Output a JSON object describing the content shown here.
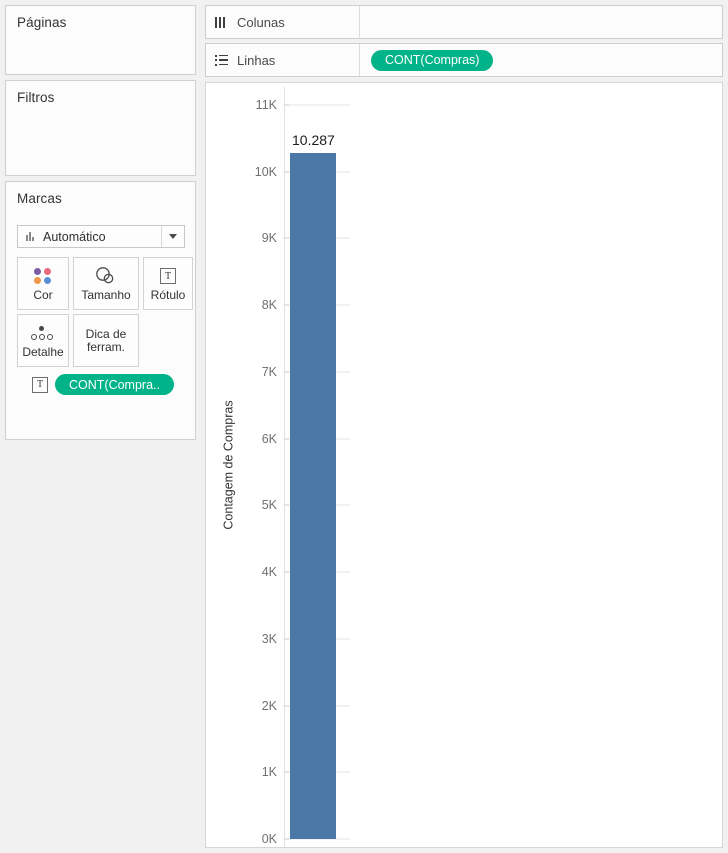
{
  "shelves": {
    "pages": {
      "title": "Páginas"
    },
    "filters": {
      "title": "Filtros"
    },
    "marks": {
      "title": "Marcas",
      "mark_type": "Automático",
      "mark_type_icon": "bar-chart-icon",
      "buttons": [
        {
          "label": "Cor",
          "icon": "color-dots-icon"
        },
        {
          "label": "Tamanho",
          "icon": "size-circles-icon"
        },
        {
          "label": "Rótulo",
          "icon": "label-text-icon"
        },
        {
          "label": "Detalhe",
          "icon": "detail-dots-icon"
        },
        {
          "label": "Dica de ferram.",
          "icon": "tooltip-icon"
        }
      ],
      "pill": {
        "label": "CONT(Compra..",
        "icon": "label-text-icon"
      }
    },
    "columns": {
      "label": "Colunas",
      "icon": "columns-icon",
      "pills": []
    },
    "rows": {
      "label": "Linhas",
      "icon": "rows-icon",
      "pill": "CONT(Compras)"
    }
  },
  "colors": {
    "pill_green": "#00b388",
    "bar_blue": "#4c78a8",
    "color_dot_purple": "#7b5ea7",
    "color_dot_pink": "#e8697d",
    "color_dot_orange": "#f0974a",
    "color_dot_blue": "#5a8fd6",
    "tick_label": "#707070",
    "gridline": "#e6e6e6"
  },
  "chart_data": {
    "type": "bar",
    "title": "",
    "xlabel": "",
    "ylabel": "Contagem de Compras",
    "categories": [
      ""
    ],
    "values": [
      10287
    ],
    "data_labels": [
      "10.287"
    ],
    "ylim": [
      0,
      11000
    ],
    "ytick_values": [
      0,
      1000,
      2000,
      3000,
      4000,
      5000,
      6000,
      7000,
      8000,
      9000,
      10000,
      11000
    ],
    "ytick_labels": [
      "0K",
      "1K",
      "2K",
      "3K",
      "4K",
      "5K",
      "6K",
      "7K",
      "8K",
      "9K",
      "10K",
      "11K"
    ],
    "grid": true,
    "legend": "none",
    "series": [
      {
        "name": "CONT(Compras)",
        "values": [
          10287
        ],
        "color": "#4c78a8"
      }
    ]
  }
}
